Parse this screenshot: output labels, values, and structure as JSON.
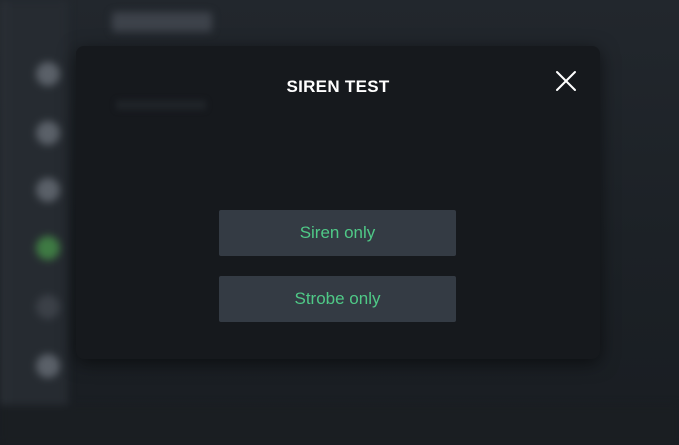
{
  "modal": {
    "title": "SIREN TEST",
    "close_icon": "close-icon",
    "buttons": [
      {
        "label": "Siren only"
      },
      {
        "label": "Strobe only"
      }
    ]
  },
  "background": {
    "sidebar_icons": [
      "nav-icon",
      "nav-icon",
      "nav-icon",
      "nav-icon-active",
      "nav-icon",
      "nav-icon"
    ]
  },
  "colors": {
    "modal_bg": "#16191d",
    "button_bg": "#343b44",
    "button_text": "#4fc987",
    "title_text": "#ffffff",
    "active_indicator": "#3e7a43"
  }
}
